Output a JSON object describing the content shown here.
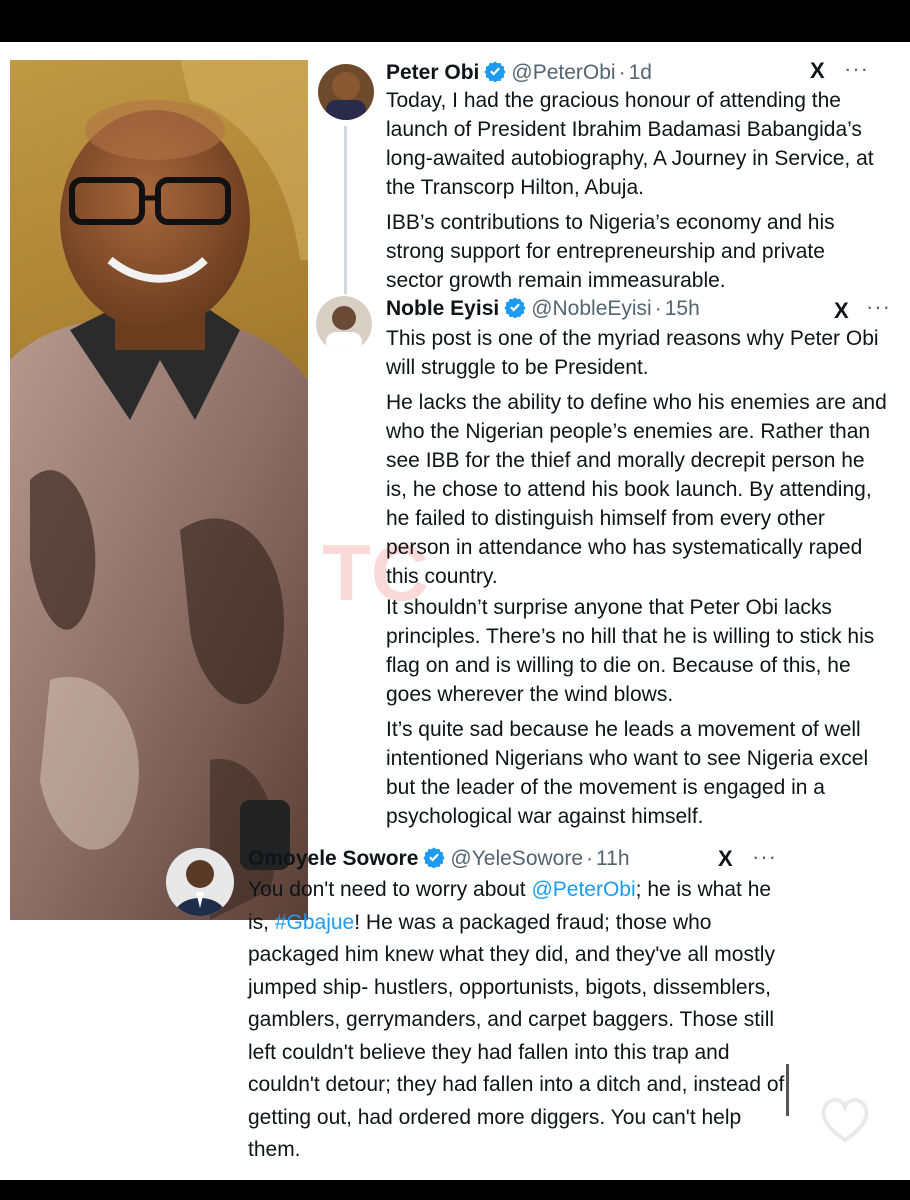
{
  "tweets": [
    {
      "name": "Peter Obi",
      "handle": "@PeterObi",
      "time": "1d",
      "paragraphs": [
        "Today, I had the gracious honour of attending the launch of President Ibrahim Badamasi Babangida’s long-awaited autobiography, A Journey in Service, at the Transcorp Hilton, Abuja.",
        "IBB’s contributions to Nigeria’s economy and his strong support for entrepreneurship and private sector growth remain immeasurable."
      ]
    },
    {
      "name": "Noble Eyisi",
      "handle": "@NobleEyisi",
      "time": "15h",
      "paragraphs": [
        "This post is one of the myriad reasons why Peter Obi will struggle to be President.",
        "He lacks the ability to define who his enemies are and who the Nigerian people’s enemies are. Rather than see IBB for the thief and morally decrepit person he is, he chose to attend his book launch. By attending, he failed to distinguish himself from every other person in attendance who has systematically raped this country.",
        "It shouldn’t surprise anyone that Peter Obi lacks principles. There’s no hill that he is willing to stick his flag on and is willing to die on. Because of this, he goes wherever the wind blows.",
        "It’s quite sad because he leads a movement of well intentioned Nigerians who want to see Nigeria excel but the leader of the movement is engaged in a psychological war against himself."
      ]
    },
    {
      "name": "Omoyele Sowore",
      "handle": "@YeleSowore",
      "time": "11h",
      "text_before_mention": "You don't need to worry about ",
      "mention": "@PeterObi",
      "text_after_mention": "; he is what he is, ",
      "hashtag": "#Gbajue",
      "text_after_hashtag": "! He was a packaged fraud; those who packaged him knew what they did, and they've all mostly jumped ship- hustlers, opportunists, bigots, dissemblers, gamblers, gerrymanders, and carpet baggers. Those still left couldn't believe they had fallen into this trap and couldn't detour; they had fallen into a ditch and, instead of getting out, had ordered more diggers. You can't help them."
    }
  ],
  "ui": {
    "x_logo": "X",
    "more": "···",
    "separator": "·",
    "likes_label": "Likes",
    "watermark": "TC"
  },
  "colors": {
    "verified": "#1d9bf0",
    "link": "#1d9bf0",
    "thread_line": "#cfd9de"
  },
  "icons": [
    "verified-badge-icon",
    "x-logo-icon",
    "more-options-icon",
    "heart-icon"
  ]
}
